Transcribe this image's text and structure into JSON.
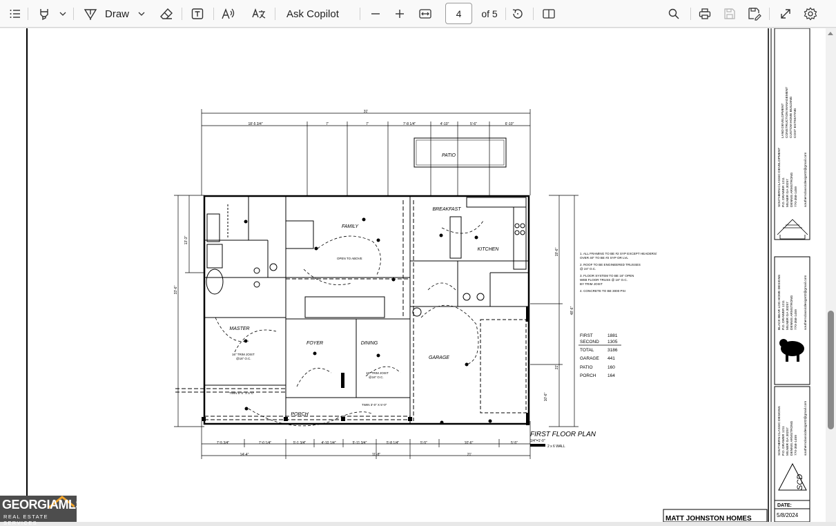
{
  "toolbar": {
    "draw_label": "Draw",
    "copilot_label": "Ask Copilot",
    "page_current": "4",
    "page_total": "of 5"
  },
  "icons": [
    "contents-icon",
    "highlight-icon",
    "chevron-down-icon",
    "draw-icon",
    "eraser-icon",
    "text-box-icon",
    "read-aloud-icon",
    "translate-icon",
    "zoom-out-icon",
    "zoom-in-icon",
    "fit-width-icon",
    "rotate-icon",
    "page-view-icon",
    "search-icon",
    "print-icon",
    "save-icon",
    "save-as-icon",
    "fullscreen-icon",
    "settings-icon"
  ],
  "plan": {
    "title": "FIRST FLOOR PLAN",
    "scale": "1/4\"=1'-0\"",
    "wall_note": "2 x 6 WALL",
    "rooms": {
      "patio": "PATIO",
      "breakfast": "BREAKFAST",
      "family": "FAMILY",
      "kitchen": "KITCHEN",
      "master": "MASTER",
      "foyer": "FOYER",
      "dining": "DINING",
      "garage": "GARAGE",
      "porch": "PORCH",
      "wic": "WALK\nW.I.C.",
      "open_above": "OPEN TO\nABOVE"
    },
    "dims_top": [
      "31'",
      "18'-5 3/4\"",
      "7'",
      "7'",
      "7'-8 1/4\"",
      "4'-10\"",
      "5'-6\"",
      "6'-10\""
    ],
    "dims_bottom": [
      "7'-5 3/4\"",
      "7'-0 1/4\"",
      "5'-1 3/4\"",
      "4'-10 1/4\"",
      "5'-11 3/4\"",
      "5'-8 1/4\"",
      "5'-5\"",
      "10'-6\"",
      "5'-5\"",
      "14'-4\"",
      "11'-8\"",
      "21'"
    ],
    "dims_right": [
      "19'-6\"",
      "48'-6\"",
      "21'",
      "10'-6\""
    ],
    "dims_left": [
      "13'-3\"",
      "33'-6\""
    ],
    "notes": [
      "1. ALL FRAMING TO BE #2 SYP EXCEPT HEADERS/",
      "   OVER 40\" TO BE #2 SYP OR LVL",
      "2. ROOF TO BE ENGINEERED TRUSSES",
      "   @ 24\" O.C.",
      "3. FLOOR SYSTEM TO BE 16\" OPEN",
      "   WEB FLOOR TRUSS @ 16\" O.C.",
      "   BY TRIM JOIST",
      "4. CONCRETE TO BE 3000 PSI"
    ],
    "areas": [
      {
        "label": "FIRST",
        "value": "1881"
      },
      {
        "label": "SECOND",
        "value": "1305"
      },
      {
        "label": "TOTAL",
        "value": "3186"
      },
      {
        "label": "GARAGE",
        "value": "441"
      },
      {
        "label": "PATIO",
        "value": "160"
      },
      {
        "label": "PORCH",
        "value": "164"
      }
    ],
    "callouts": {
      "joist1": "16\" TRIM JOIST",
      "joist1b": "@16\" O.C.",
      "joist2": "16\" TRIM JOIST",
      "joist2b": "@16\" O.C.",
      "twin1": "TWIN 5'-0\" X 5'-0\"",
      "twin2": "TWIN 3'-0\" X 5'-0\""
    }
  },
  "title_block": {
    "company1_lines": [
      "LAND DEVELOPMENT",
      "CONSTRUCTION MANAGEMENT",
      "CUSTOM HOME BUILDING",
      "COST ESTIMATING"
    ],
    "company1_name": [
      "SOUTHERN CLASSIC DEVELOPMENT",
      "P.O. DRAWER 1211",
      "MILNER GA 30257",
      "DENNIS ARMSTRONG",
      "770-358-1459",
      "southernclassicdesign02@gmail.com"
    ],
    "company2_name": [
      "BLACK BEAR LOG HOME DESIGNS",
      "P.O. DRAWER 1211",
      "MILNER GA 30257",
      "DENNIS ARMSTRONG",
      "770-358-1459",
      "southernclassicdesign02@gmail.com"
    ],
    "company3_name": [
      "SOUTHERN CLASSIC DESIGNS",
      "P.O. DRAWER 1211",
      "MILNER GA 30257",
      "DENNIS ARMSTRONG",
      "770-358-1459",
      "southernclassicdesign02@gmail.com"
    ],
    "date_label": "DATE:",
    "date_value": "5/8/2024",
    "client": "MATT JOHNSTON HOMES",
    "logo_text": "SCD"
  },
  "watermark": {
    "brand": "GEORGIAMLS",
    "sub": "REAL ESTATE SERVICES"
  }
}
